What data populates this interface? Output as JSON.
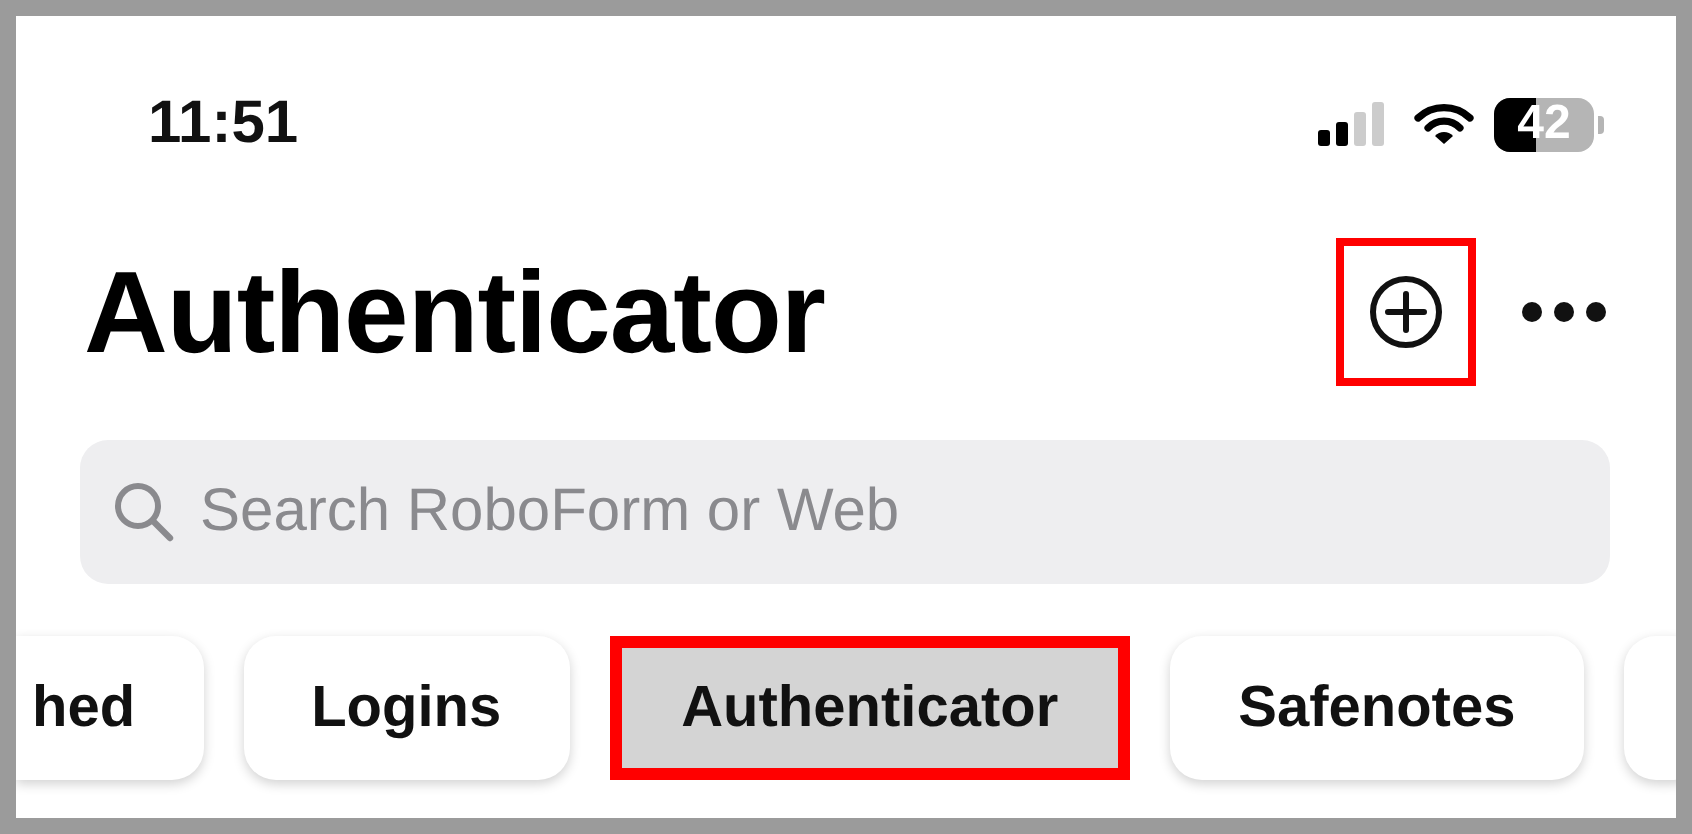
{
  "status_bar": {
    "time": "11:51",
    "battery": "42"
  },
  "header": {
    "title": "Authenticator",
    "add_button": {
      "highlighted": true
    }
  },
  "search": {
    "placeholder": "Search RoboForm or Web"
  },
  "chips": [
    {
      "label": "hed",
      "selected": false,
      "highlighted": false
    },
    {
      "label": "Logins",
      "selected": false,
      "highlighted": false
    },
    {
      "label": "Authenticator",
      "selected": true,
      "highlighted": true
    },
    {
      "label": "Safenotes",
      "selected": false,
      "highlighted": false
    }
  ]
}
